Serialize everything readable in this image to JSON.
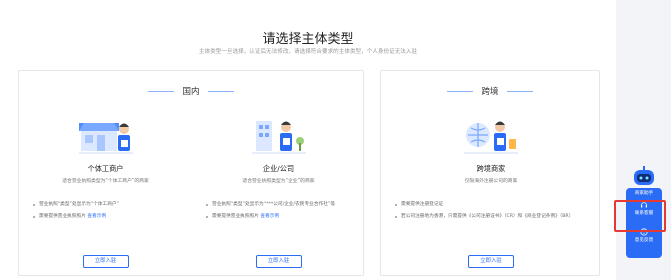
{
  "header": {
    "title": "请选择主体类型",
    "subtitle": "主体类型一旦选择，认证后无法修改，请选择符合要求的主体类型，个人身份证无法入驻"
  },
  "domestic": {
    "label": "国内",
    "cards": [
      {
        "title": "个体工商户",
        "desc": "适合营业执照类型为“个体工商户”的商家",
        "bullets": [
          {
            "text": "营业执照“类型”处显示为“个体工商户”",
            "link": ""
          },
          {
            "text": "需要提供营业执照照片",
            "link": "查看示例"
          }
        ],
        "button": "立即入驻"
      },
      {
        "title": "企业/公司",
        "desc": "适合营业执照类型为“企业”的商家",
        "bullets": [
          {
            "text": "营业执照“类型”处显示为“***公司/企业/农民专业合作社”等",
            "link": ""
          },
          {
            "text": "需要提供营业执照照片",
            "link": "查看示例"
          }
        ],
        "button": "立即入驻"
      }
    ]
  },
  "cross": {
    "label": "跨境",
    "card": {
      "title": "跨境商家",
      "desc": "仅限海外注册公司的商家",
      "bullets": [
        {
          "text": "需要提供注册登记证",
          "link": ""
        },
        {
          "text": "若公司注册地为香港，只需提供《公司注册证书》（CR）和《商业登记条例》（BR）",
          "link": ""
        }
      ],
      "button": "立即入驻"
    }
  },
  "helper": {
    "top_label": "商家助手",
    "button1": "联系客服",
    "button2": "意见反馈"
  },
  "colors": {
    "accent": "#2a6cf6",
    "highlight": "#e53935"
  }
}
